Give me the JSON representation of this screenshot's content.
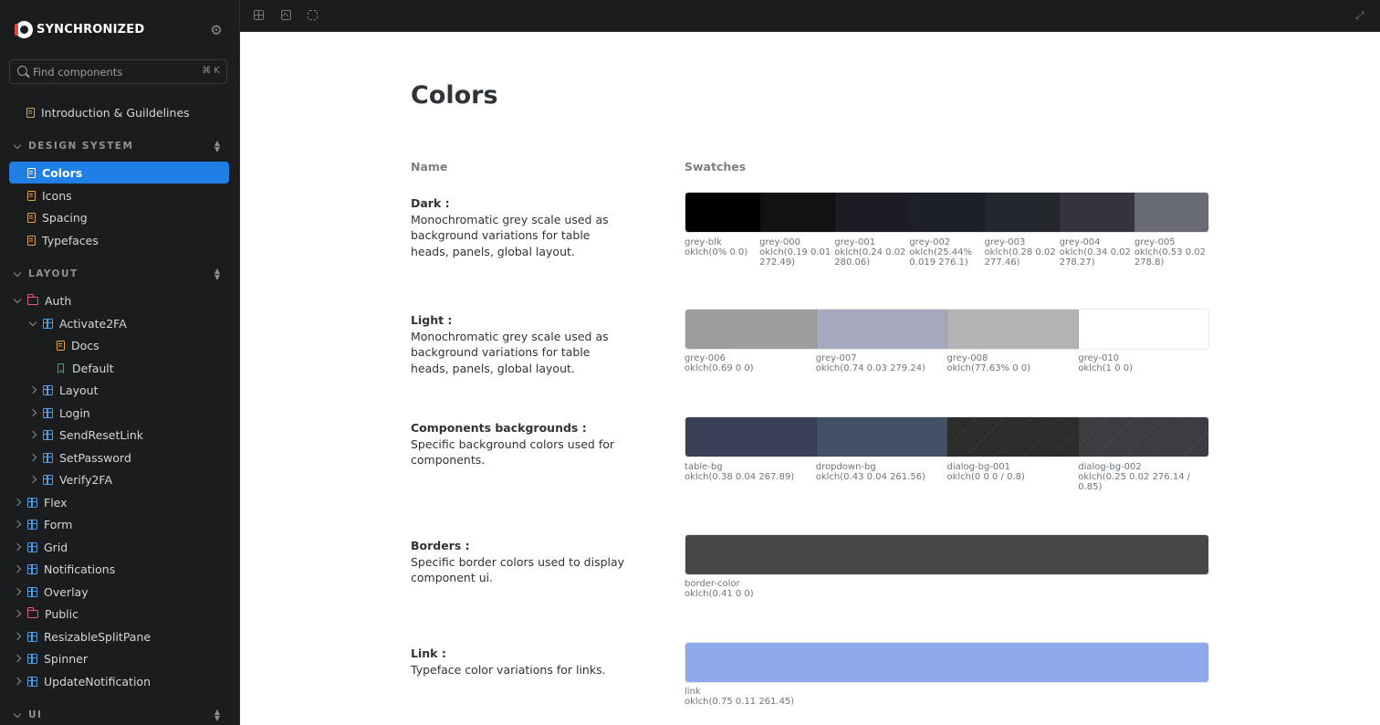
{
  "sidebar": {
    "brand": "SYNCHRONIZED",
    "search": {
      "placeholder": "Find components",
      "shortcut": "⌘ K"
    },
    "top_items": [
      {
        "label": "Introduction & Guildelines",
        "icon": "doc-icon"
      }
    ],
    "sections": [
      {
        "label": "DESIGN SYSTEM",
        "items": [
          "Colors",
          "Icons",
          "Spacing",
          "Typefaces"
        ]
      },
      {
        "label": "LAYOUT",
        "items": [
          "Auth",
          "Activate2FA",
          "Docs",
          "Default",
          "Layout",
          "Login",
          "SendResetLink",
          "SetPassword",
          "Verify2FA",
          "Flex",
          "Form",
          "Grid",
          "Notifications",
          "Overlay",
          "Public",
          "ResizableSplitPane",
          "Spinner",
          "UpdateNotification"
        ]
      },
      {
        "label": "UI",
        "items": []
      }
    ],
    "active_item": "Colors"
  },
  "main": {
    "title": "Colors",
    "columns": {
      "name": "Name",
      "swatches": "Swatches"
    },
    "groups": [
      {
        "title": "Dark :",
        "description": "Monochromatic grey scale used as background variations for table heads, panels, global layout.",
        "swatches": [
          {
            "name": "grey-blk",
            "value": "oklch(0% 0 0)",
            "color": "#000000"
          },
          {
            "name": "grey-000",
            "value": "oklch(0.19 0.01 272.49)",
            "color": "#111214"
          },
          {
            "name": "grey-001",
            "value": "oklch(0.24 0.02 280.06)",
            "color": "#1b1c24"
          },
          {
            "name": "grey-002",
            "value": "oklch(25.44% 0.019 276.1)",
            "color": "#1e2029"
          },
          {
            "name": "grey-003",
            "value": "oklch(0.28 0.02 277.46)",
            "color": "#25272f"
          },
          {
            "name": "grey-004",
            "value": "oklch(0.34 0.02 278.27)",
            "color": "#33343f"
          },
          {
            "name": "grey-005",
            "value": "oklch(0.53 0.02 278.8)",
            "color": "#686a76"
          }
        ]
      },
      {
        "title": "Light :",
        "description": "Monochromatic grey scale used as background variations for table heads, panels, global layout.",
        "swatches": [
          {
            "name": "grey-006",
            "value": "oklch(0.69 0 0)",
            "color": "#9d9d9d"
          },
          {
            "name": "grey-007",
            "value": "oklch(0.74 0.03 279.24)",
            "color": "#a6a8be"
          },
          {
            "name": "grey-008",
            "value": "oklch(77.63% 0 0)",
            "color": "#b4b4b4"
          },
          {
            "name": "grey-010",
            "value": "oklch(1 0 0)",
            "color": "#ffffff"
          }
        ]
      },
      {
        "title": "Components backgrounds :",
        "description": "Specific background colors used for components.",
        "swatches": [
          {
            "name": "table-bg",
            "value": "oklch(0.38 0.04 267.89)",
            "color": "#3a4056"
          },
          {
            "name": "dropdown-bg",
            "value": "oklch(0.43 0.04 261.56)",
            "color": "#445065"
          },
          {
            "name": "dialog-bg-001",
            "value": "oklch(0 0 0 / 0.8)",
            "color": "#2c2c2c"
          },
          {
            "name": "dialog-bg-002",
            "value": "oklch(0.25 0.02 276.14 / 0.85)",
            "color": "#3c3c42"
          }
        ]
      },
      {
        "title": "Borders :",
        "description": "Specific border colors used to display component ui.",
        "swatches": [
          {
            "name": "border-color",
            "value": "oklch(0.41 0 0)",
            "color": "#474747"
          }
        ]
      },
      {
        "title": "Link :",
        "description": "Typeface color variations for links.",
        "swatches": [
          {
            "name": "link",
            "value": "oklch(0.75 0.11 261.45)",
            "color": "#8eaaec"
          }
        ]
      }
    ]
  },
  "colors": {
    "accent": "#1f7fe5",
    "sidebar_bg": "#1b1c1d",
    "doc_icon": "#e3a44a",
    "component_icon": "#4c9ee8",
    "folder_icon": "#e0578a",
    "story_icon": "#2ea87a"
  }
}
